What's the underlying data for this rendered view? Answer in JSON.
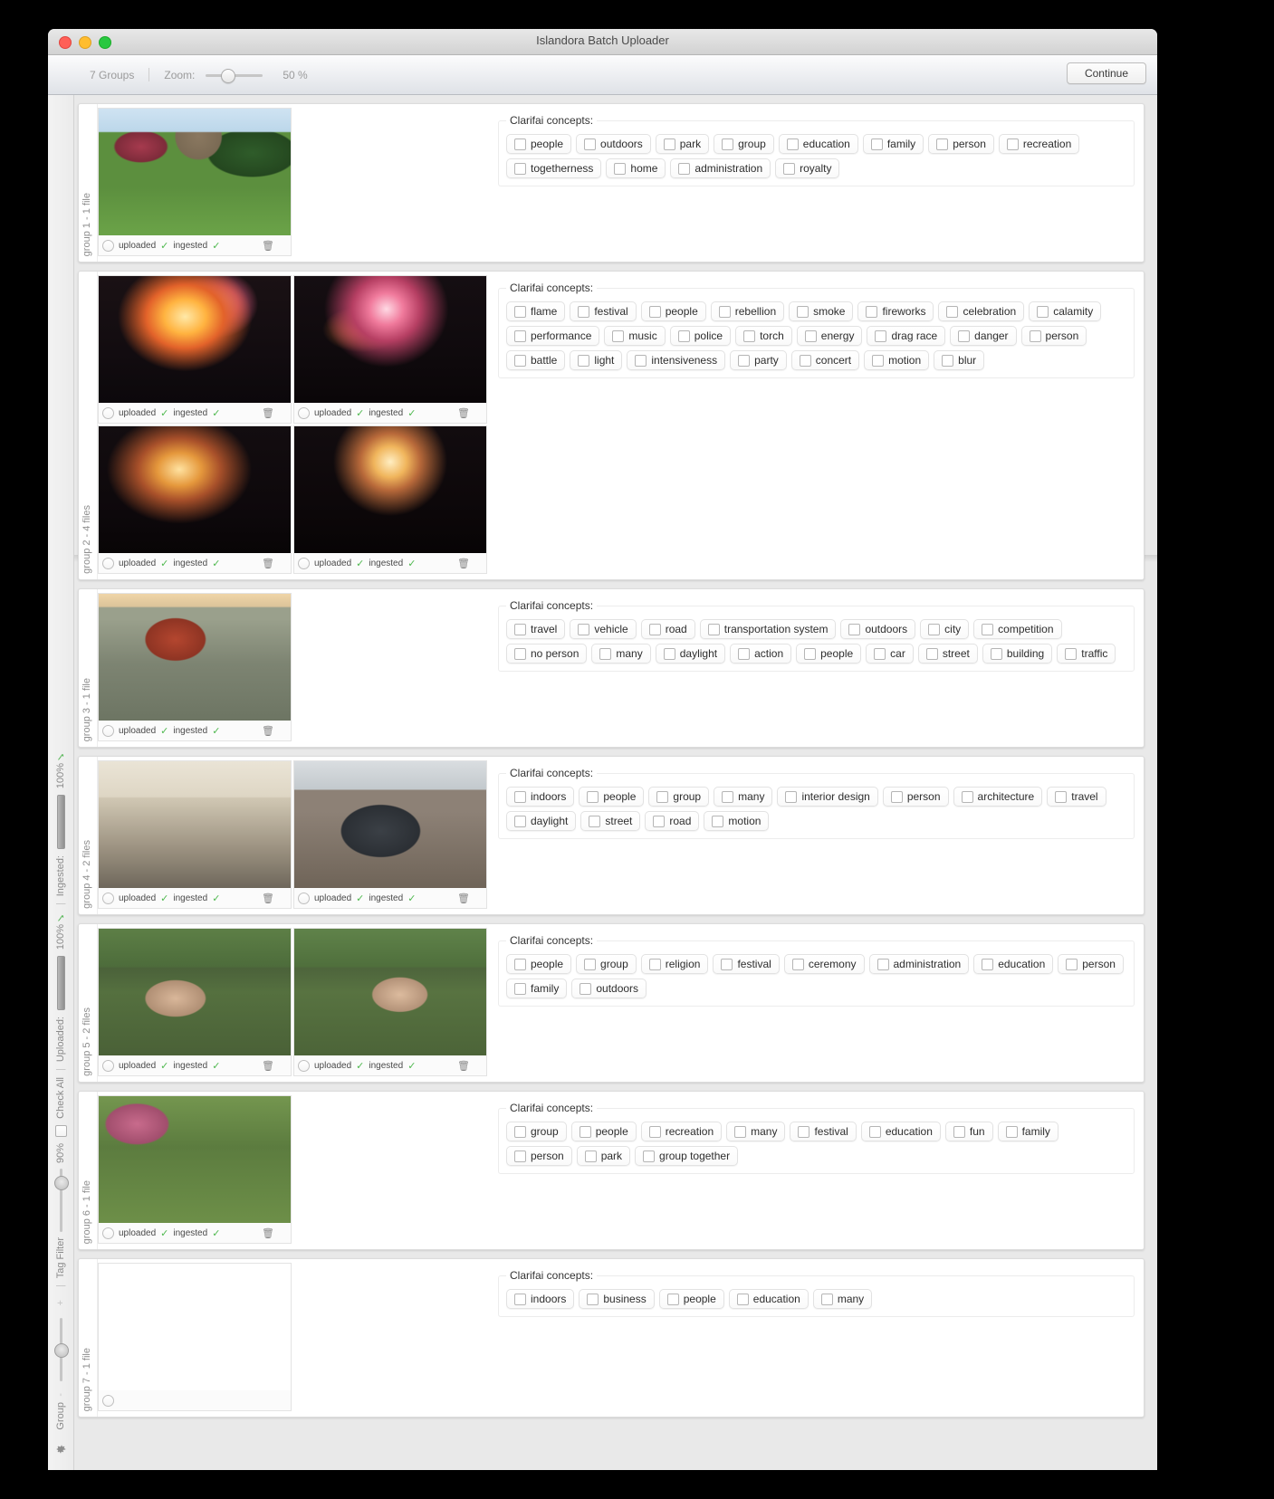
{
  "window": {
    "title": "Islandora Batch Uploader",
    "traffic_lights": [
      "close",
      "minimize",
      "maximize"
    ]
  },
  "toolbar": {
    "groups_label": "7 Groups",
    "zoom_label": "Zoom:",
    "zoom_value": "50 %",
    "continue_label": "Continue"
  },
  "sidebar": {
    "ingested_label": "Ingested:",
    "ingested_pct": "100%",
    "uploaded_label": "Uploaded:",
    "uploaded_pct": "100%",
    "check_all_label": "Check All",
    "tag_filter_label": "Tag Filter",
    "tag_filter_pct": "90%",
    "group_label": "Group",
    "group_plus": "+",
    "group_minus": "-",
    "settings_icon": "gear-icon",
    "separator": "|"
  },
  "common": {
    "concepts_legend": "Clarifai concepts:",
    "uploaded_status": "uploaded",
    "ingested_status": "ingested",
    "check_glyph": "✓",
    "trash_icon": "trash-icon"
  },
  "groups": [
    {
      "label": "group 1 - 1 file",
      "thumbs": [
        {
          "photo": "p-campus",
          "uploaded": "uploaded",
          "ingested": "ingested"
        }
      ],
      "concepts": [
        "people",
        "outdoors",
        "park",
        "group",
        "education",
        "family",
        "person",
        "recreation",
        "togetherness",
        "home",
        "administration",
        "royalty"
      ]
    },
    {
      "label": "group 2 - 4 files",
      "thumbs": [
        {
          "photo": "p-fire1",
          "uploaded": "uploaded",
          "ingested": "ingested"
        },
        {
          "photo": "p-fire2",
          "uploaded": "uploaded",
          "ingested": "ingested"
        },
        {
          "photo": "p-fire3",
          "uploaded": "uploaded",
          "ingested": "ingested"
        },
        {
          "photo": "p-fire4",
          "uploaded": "uploaded",
          "ingested": "ingested"
        }
      ],
      "concepts": [
        "flame",
        "festival",
        "people",
        "rebellion",
        "smoke",
        "fireworks",
        "celebration",
        "calamity",
        "performance",
        "music",
        "police",
        "torch",
        "energy",
        "drag race",
        "danger",
        "person",
        "battle",
        "light",
        "intensiveness",
        "party",
        "concert",
        "motion",
        "blur"
      ]
    },
    {
      "label": "group 3 - 1 file",
      "thumbs": [
        {
          "photo": "p-aerial",
          "uploaded": "uploaded",
          "ingested": "ingested"
        }
      ],
      "concepts": [
        "travel",
        "vehicle",
        "road",
        "transportation system",
        "outdoors",
        "city",
        "competition",
        "no person",
        "many",
        "daylight",
        "action",
        "people",
        "car",
        "street",
        "building",
        "traffic"
      ]
    },
    {
      "label": "group 4 - 2 files",
      "thumbs": [
        {
          "photo": "p-hall",
          "uploaded": "uploaded",
          "ingested": "ingested"
        },
        {
          "photo": "p-street",
          "uploaded": "uploaded",
          "ingested": "ingested"
        }
      ],
      "concepts": [
        "indoors",
        "people",
        "group",
        "many",
        "interior design",
        "person",
        "architecture",
        "travel",
        "daylight",
        "street",
        "road",
        "motion"
      ]
    },
    {
      "label": "group 5 - 2 files",
      "thumbs": [
        {
          "photo": "p-crowd1",
          "uploaded": "uploaded",
          "ingested": "ingested"
        },
        {
          "photo": "p-crowd2",
          "uploaded": "uploaded",
          "ingested": "ingested"
        }
      ],
      "concepts": [
        "people",
        "group",
        "religion",
        "festival",
        "ceremony",
        "administration",
        "education",
        "person",
        "family",
        "outdoors"
      ]
    },
    {
      "label": "group 6 - 1 file",
      "thumbs": [
        {
          "photo": "p-park",
          "uploaded": "uploaded",
          "ingested": "ingested"
        }
      ],
      "concepts": [
        "group",
        "people",
        "recreation",
        "many",
        "festival",
        "education",
        "fun",
        "family",
        "person",
        "park",
        "group together"
      ]
    },
    {
      "label": "group 7 - 1 file",
      "thumbs": [
        {
          "photo": "p-timber",
          "uploaded": "",
          "ingested": ""
        }
      ],
      "concepts": [
        "indoors",
        "business",
        "people",
        "education",
        "many"
      ]
    }
  ]
}
